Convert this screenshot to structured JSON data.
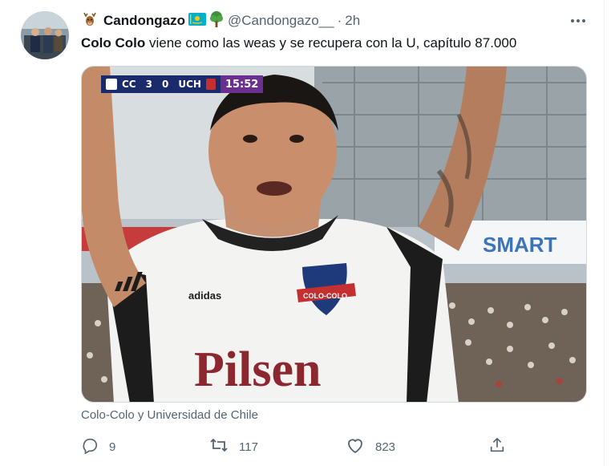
{
  "tweet": {
    "display_name": "Candongazo",
    "handle": "@Candongazo__",
    "time": "2h",
    "separator": "·",
    "text_bold": "Colo Colo",
    "text_rest": " viene como las weas y se recupera con la U, capítulo 87.000"
  },
  "media": {
    "caption": "Colo-Colo y Universidad de Chile",
    "scoreboard": {
      "home": "CC",
      "home_score": "3",
      "away_score": "0",
      "away": "UCH",
      "clock": "15:52"
    },
    "jersey_sponsor": "Pilsen",
    "stadium_sign": "SMART",
    "crest_text": "COLO-COLO",
    "kit_brand": "adidas"
  },
  "actions": {
    "replies": "9",
    "retweets": "117",
    "likes": "823"
  },
  "colors": {
    "text_secondary": "#536471",
    "border": "#cfd9de",
    "scoreboard_bg": "#1a2a6b",
    "clock_bg": "#6a2f8f"
  },
  "icons": [
    "deer-emoji-icon",
    "kazakhstan-flag-icon",
    "tree-emoji-icon",
    "more-icon",
    "reply-icon",
    "retweet-icon",
    "like-icon",
    "share-icon"
  ]
}
